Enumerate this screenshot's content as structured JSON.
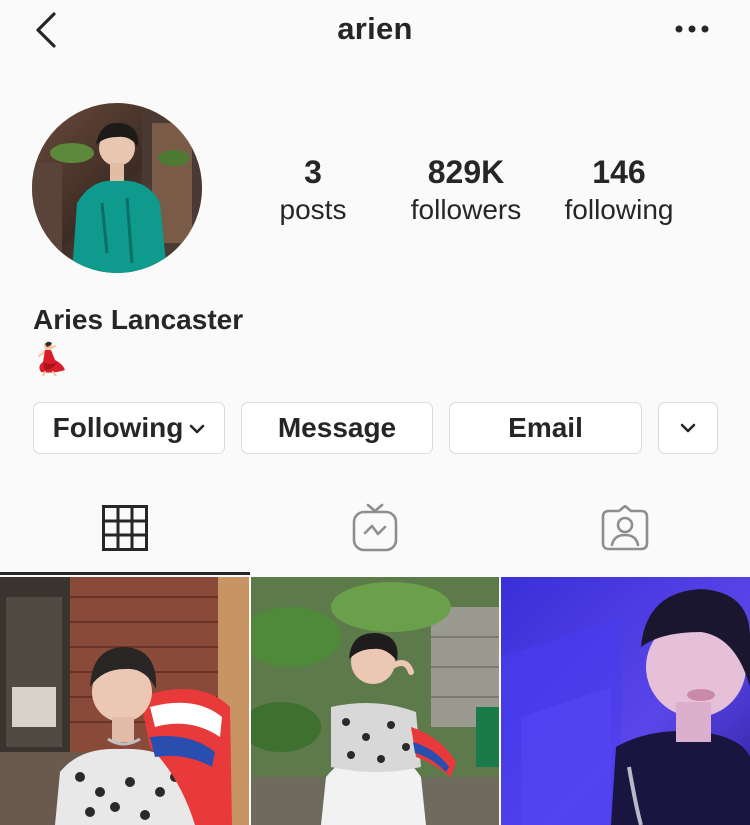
{
  "header": {
    "username": "arien"
  },
  "profile": {
    "full_name": "Aries Lancaster",
    "bio_emoji": "dancer-emoji"
  },
  "stats": {
    "posts": {
      "count": "3",
      "label": "posts"
    },
    "followers": {
      "count": "829K",
      "label": "followers"
    },
    "following": {
      "count": "146",
      "label": "following"
    }
  },
  "actions": {
    "following_label": "Following",
    "message_label": "Message",
    "email_label": "Email"
  },
  "tabs": [
    {
      "icon": "grid-icon",
      "active": true
    },
    {
      "icon": "igtv-icon",
      "active": false
    },
    {
      "icon": "tagged-icon",
      "active": false
    }
  ],
  "colors": {
    "background": "#fafafa",
    "text": "#262626",
    "border": "#dbdbdb"
  }
}
